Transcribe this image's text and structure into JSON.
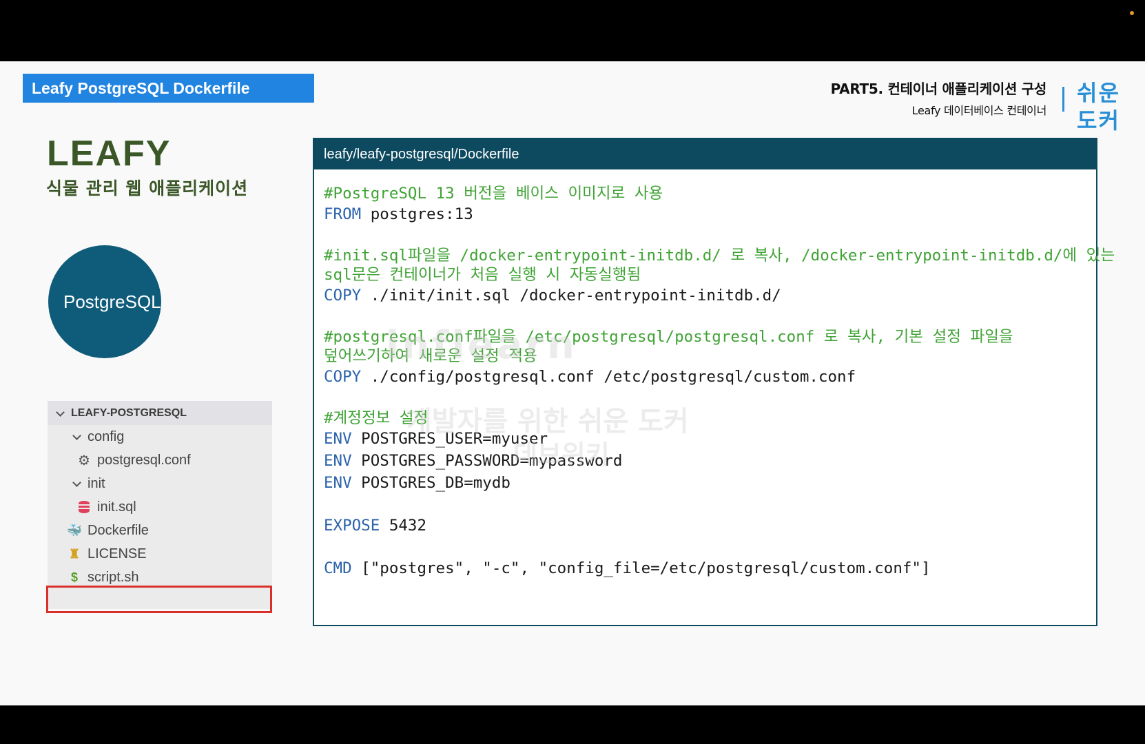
{
  "slide": {
    "title": "Leafy PostgreSQL Dockerfile",
    "part_title": "PART5. 컨테이너 애플리케이션 구성",
    "part_subtitle": "Leafy 데이터베이스 컨테이너",
    "brand_line1": "쉬운",
    "brand_line2": "도커"
  },
  "app": {
    "name": "LEAFY",
    "description": "식물 관리 웹 애플리케이션",
    "tech_badge": "PostgreSQL"
  },
  "explorer": {
    "root": "LEAFY-POSTGRESQL",
    "items": [
      {
        "label": "config",
        "type": "folder",
        "icon": "chevron-down-icon"
      },
      {
        "label": "postgresql.conf",
        "type": "file",
        "icon": "gear-icon"
      },
      {
        "label": "init",
        "type": "folder",
        "icon": "chevron-down-icon"
      },
      {
        "label": "init.sql",
        "type": "file",
        "icon": "database-icon"
      },
      {
        "label": "Dockerfile",
        "type": "file",
        "icon": "docker-icon",
        "highlighted": true
      },
      {
        "label": "LICENSE",
        "type": "file",
        "icon": "license-icon"
      },
      {
        "label": "script.sh",
        "type": "file",
        "icon": "dollar-icon"
      }
    ],
    "highlight_color": "#d9302a"
  },
  "code": {
    "path": "leafy/leafy-postgresql/Dockerfile",
    "lines": [
      {
        "comment": "#PostgreSQL 13 버전을 베이스 이미지로 사용"
      },
      {
        "keyword": "FROM",
        "text": " postgres:13"
      },
      {
        "comment": "#init.sql파일을 /docker-entrypoint-initdb.d/ 로 복사, /docker-entrypoint-initdb.d/에 있는"
      },
      {
        "comment": "sql문은 컨테이너가 처음 실행 시 자동실행됨"
      },
      {
        "keyword": "COPY",
        "text": " ./init/init.sql /docker-entrypoint-initdb.d/"
      },
      {
        "comment": "#postgresql.conf파일을 /etc/postgresql/postgresql.conf 로 복사, 기본 설정 파일을"
      },
      {
        "comment": "덮어쓰기하여 새로운 설정 적용"
      },
      {
        "keyword": "COPY",
        "text": " ./config/postgresql.conf /etc/postgresql/custom.conf"
      },
      {
        "comment": "#계정정보 설정"
      },
      {
        "keyword": "ENV",
        "text": " POSTGRES_USER=myuser"
      },
      {
        "keyword": "ENV",
        "text": " POSTGRES_PASSWORD=mypassword"
      },
      {
        "keyword": "ENV",
        "text": " POSTGRES_DB=mydb"
      },
      {
        "keyword": "EXPOSE",
        "text": " 5432"
      },
      {
        "keyword": "CMD",
        "text": " [\"postgres\", \"-c\", \"config_file=/etc/postgresql/custom.conf\"]"
      }
    ]
  },
  "watermark": {
    "line1": "inflearn",
    "line2": "개발자를 위한 쉬운 도커",
    "line3": "데브위키"
  },
  "colors": {
    "title_bar": "#2184e0",
    "code_header": "#0e4a5f",
    "comment": "#3fa334",
    "keyword": "#2a62ab",
    "leafy_green": "#3b5727",
    "badge": "#0f5b7a"
  }
}
